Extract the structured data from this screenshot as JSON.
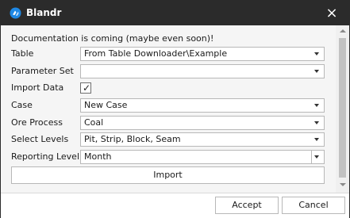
{
  "window": {
    "title": "Blandr"
  },
  "form": {
    "intro_text": "Documentation is coming (maybe even soon)!",
    "table": {
      "label": "Table",
      "value": "From Table Downloader\\Example"
    },
    "parameter_set": {
      "label": "Parameter Set",
      "value": ""
    },
    "import_data": {
      "label": "Import Data",
      "checked": true,
      "check_glyph": "✓"
    },
    "case": {
      "label": "Case",
      "value": "New Case"
    },
    "ore_process": {
      "label": "Ore Process",
      "value": "Coal"
    },
    "select_levels": {
      "label": "Select Levels",
      "value": "Pit, Strip, Block, Seam"
    },
    "reporting_level": {
      "label": "Reporting Level",
      "value": "Month"
    },
    "import_button": "Import"
  },
  "footer": {
    "accept_label": "Accept",
    "cancel_label": "Cancel"
  },
  "colors": {
    "titlebar": "#2b2b2b",
    "icon_blue": "#1e88e5",
    "background": "#f5f5f5"
  }
}
